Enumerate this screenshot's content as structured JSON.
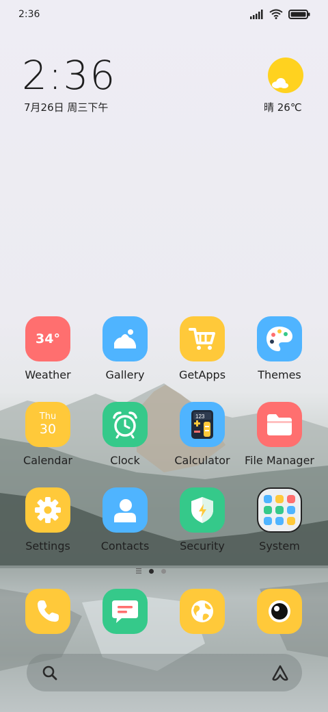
{
  "status_bar": {
    "time": "2:36"
  },
  "lock_widget": {
    "time": "2:36",
    "date": "7月26日 周三下午"
  },
  "weather_widget": {
    "text": "晴 26℃"
  },
  "apps": [
    {
      "label": "Weather",
      "icon": "weather-icon",
      "badge": "34°",
      "color": "#ff6f6f"
    },
    {
      "label": "Gallery",
      "icon": "gallery-icon",
      "color": "#4fb4ff"
    },
    {
      "label": "GetApps",
      "icon": "cart-icon",
      "color": "#ffc93a"
    },
    {
      "label": "Themes",
      "icon": "palette-icon",
      "color": "#4fb4ff"
    },
    {
      "label": "Calendar",
      "icon": "calendar-icon",
      "day": "Thu",
      "date": "30",
      "color": "#ffc93a"
    },
    {
      "label": "Clock",
      "icon": "alarm-clock-icon",
      "color": "#35c98a"
    },
    {
      "label": "Calculator",
      "icon": "calculator-icon",
      "display": "123",
      "color": "#4fb4ff"
    },
    {
      "label": "File Manager",
      "icon": "folder-icon",
      "color": "#ff6f6f"
    },
    {
      "label": "Settings",
      "icon": "gear-icon",
      "color": "#ffc93a"
    },
    {
      "label": "Contacts",
      "icon": "person-icon",
      "color": "#4fb4ff"
    },
    {
      "label": "Security",
      "icon": "shield-icon",
      "color": "#35c98a"
    },
    {
      "label": "System",
      "icon": "folder-grid-icon",
      "color": "#eeeeee"
    }
  ],
  "dock": [
    {
      "name": "phone",
      "icon": "phone-icon",
      "color": "#ffc93a"
    },
    {
      "name": "messages",
      "icon": "message-icon",
      "color": "#35c98a"
    },
    {
      "name": "browser",
      "icon": "globe-icon",
      "color": "#ffc93a"
    },
    {
      "name": "camera",
      "icon": "camera-icon",
      "color": "#ffc93a"
    }
  ],
  "search_bar": {
    "left_icon": "search-icon",
    "right_icon": "assistant-icon"
  }
}
